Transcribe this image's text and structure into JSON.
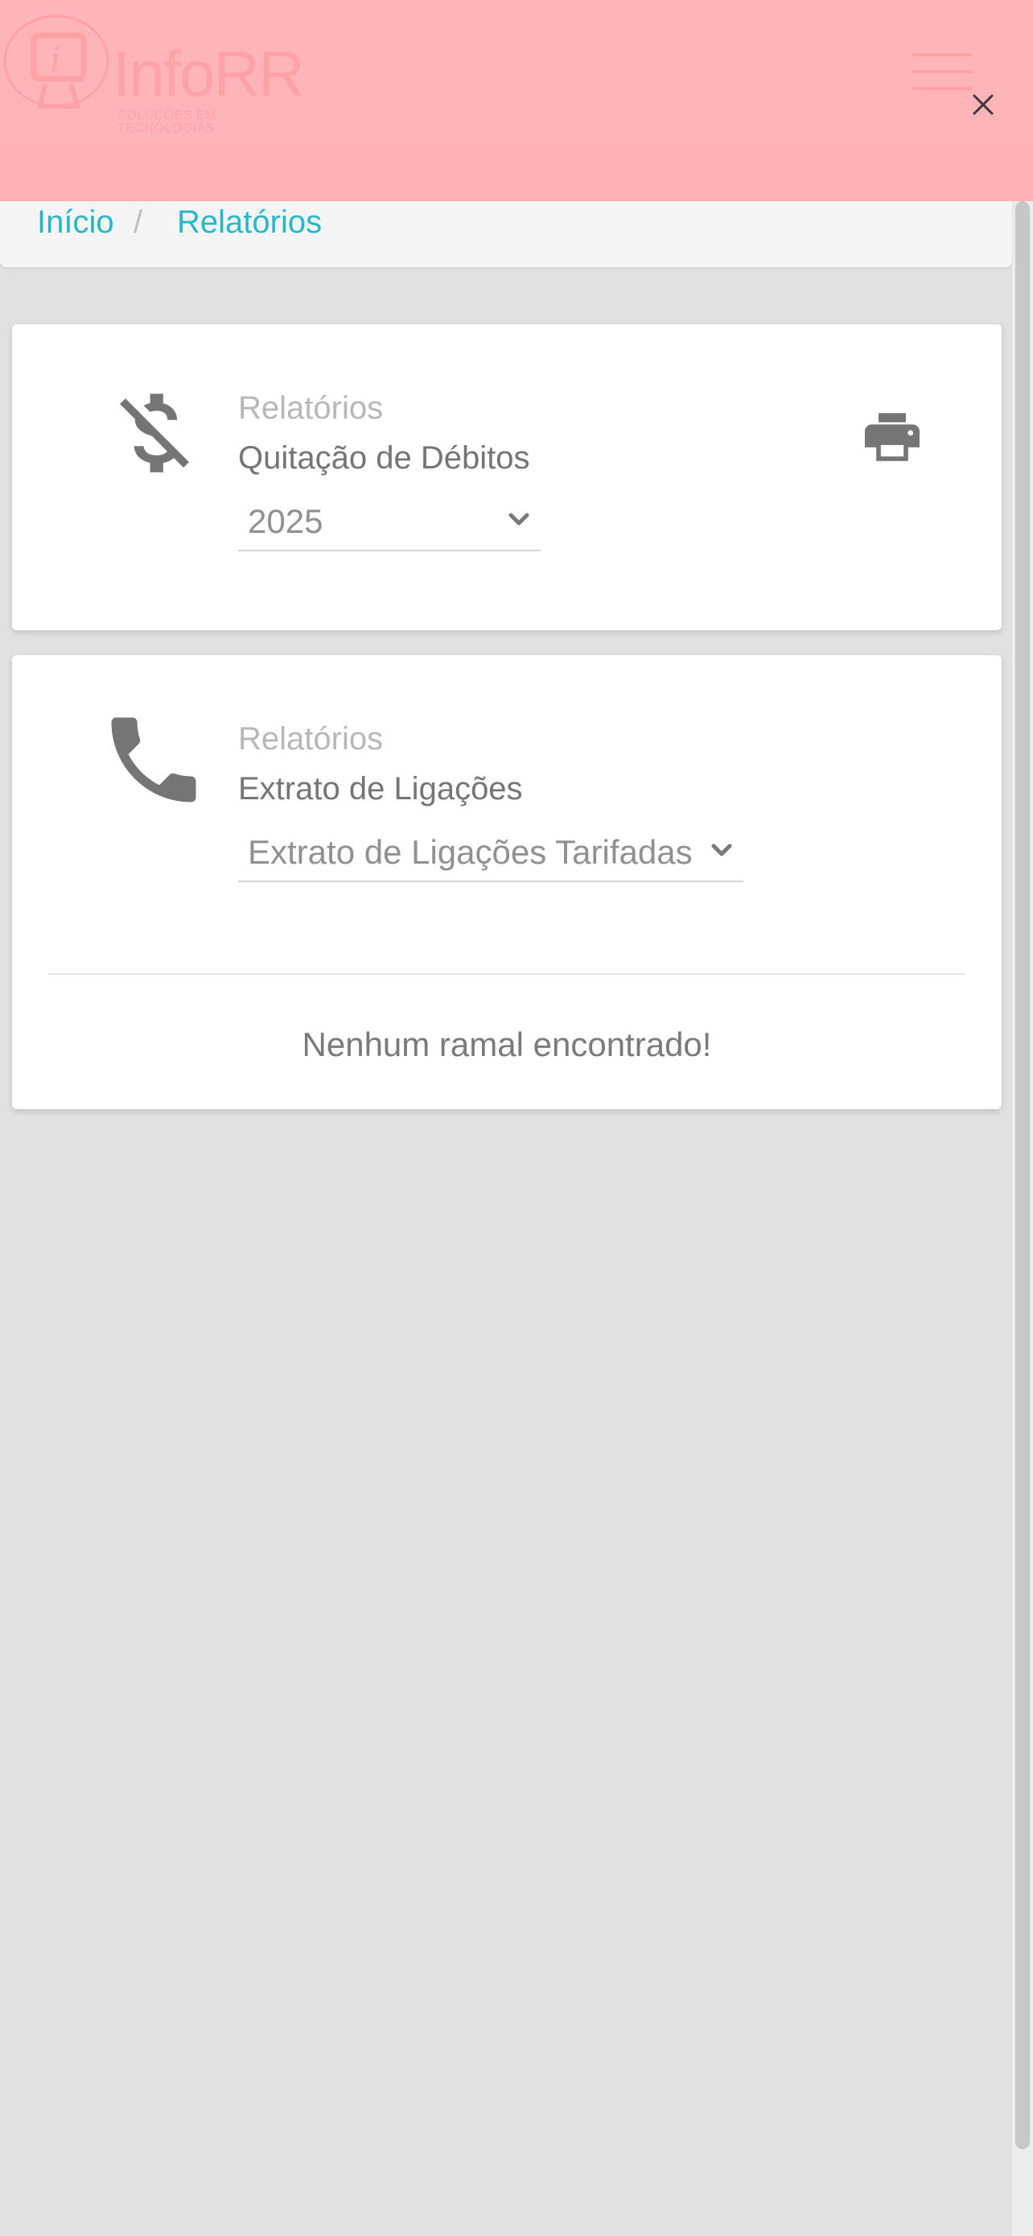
{
  "header": {
    "logo_name": "InfoRR",
    "logo_tagline": "SOLUÇÕES EM TECNOLOGIAS",
    "close_label": "×",
    "colors": {
      "background": "#ffb4b8",
      "logo": "#ffa2a7"
    }
  },
  "breadcrumb": {
    "items": [
      {
        "label": "Início"
      },
      {
        "label": "Relatórios"
      }
    ],
    "separator": "/",
    "link_color": "#26b8c6"
  },
  "cards": [
    {
      "icon": "money-off-icon",
      "eyebrow": "Relatórios",
      "title": "Quitação de Débitos",
      "select_value": "2025",
      "action_icon": "print-icon"
    },
    {
      "icon": "phone-icon",
      "eyebrow": "Relatórios",
      "title": "Extrato de Ligações",
      "select_value": "Extrato de Ligações Tarifadas",
      "empty_message": "Nenhum ramal encontrado!"
    }
  ]
}
